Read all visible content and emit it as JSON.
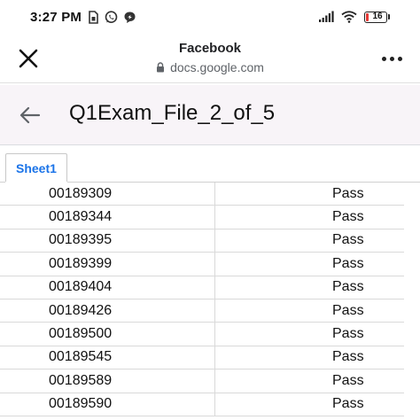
{
  "status_bar": {
    "time": "3:27 PM",
    "battery_level": "16",
    "icons": [
      "sim-notification-icon",
      "whatsapp-icon",
      "chat-bubble-icon",
      "signal-icon",
      "wifi-icon",
      "battery-icon"
    ]
  },
  "browser": {
    "site_title": "Facebook",
    "url": "docs.google.com"
  },
  "document": {
    "title": "Q1Exam_File_2_of_5"
  },
  "sheet_tabs": [
    {
      "label": "Sheet1",
      "active": true
    }
  ],
  "rows": [
    {
      "id": "00189309",
      "result": "Pass"
    },
    {
      "id": "00189344",
      "result": "Pass"
    },
    {
      "id": "00189395",
      "result": "Pass"
    },
    {
      "id": "00189399",
      "result": "Pass"
    },
    {
      "id": "00189404",
      "result": "Pass"
    },
    {
      "id": "00189426",
      "result": "Pass"
    },
    {
      "id": "00189500",
      "result": "Pass"
    },
    {
      "id": "00189545",
      "result": "Pass"
    },
    {
      "id": "00189589",
      "result": "Pass"
    },
    {
      "id": "00189590",
      "result": "Pass"
    }
  ],
  "colors": {
    "tab_accent": "#1a73e8",
    "header_bg": "#f8f4f8",
    "battery_low": "#e53935"
  }
}
